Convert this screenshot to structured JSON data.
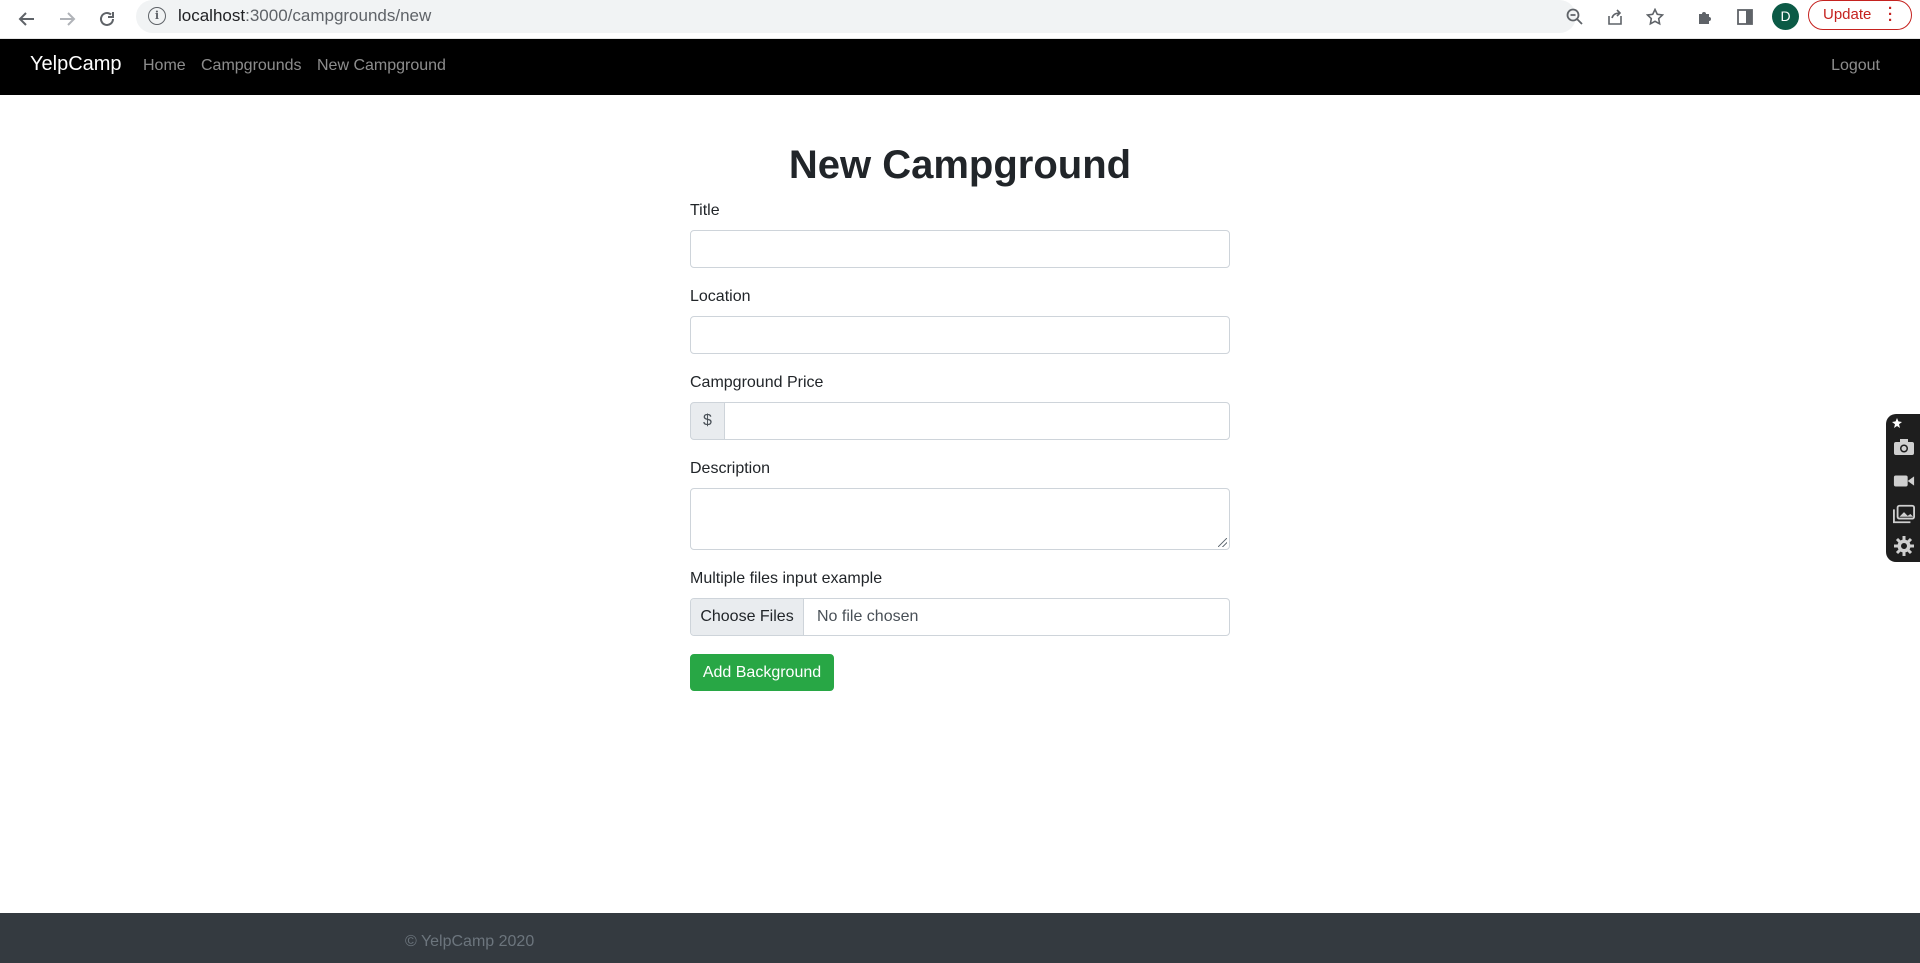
{
  "browser": {
    "url_host": "localhost",
    "url_path": ":3000/campgrounds/new",
    "profile_initial": "D",
    "update_label": "Update"
  },
  "navbar": {
    "brand": "YelpCamp",
    "links": [
      "Home",
      "Campgrounds",
      "New Campground"
    ],
    "logout": "Logout"
  },
  "form": {
    "title": "New Campground",
    "title_label": "Title",
    "location_label": "Location",
    "price_label": "Campground Price",
    "price_prefix": "$",
    "description_label": "Description",
    "files_label": "Multiple files input example",
    "choose_files": "Choose Files",
    "file_status": "No file chosen",
    "submit": "Add Background"
  },
  "footer": {
    "text": "© YelpCamp 2020"
  },
  "colors": {
    "navbar_bg": "#000000",
    "submit_bg": "#28a745",
    "footer_bg": "#343a40"
  }
}
